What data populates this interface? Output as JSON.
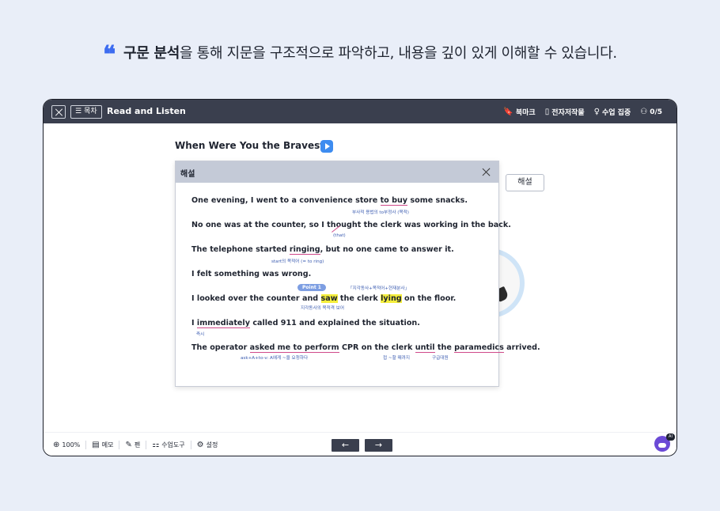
{
  "headline": {
    "quote": "❝",
    "bold": "구문 분석",
    "rest": "을 통해 지문을 구조적으로 파악하고, 내용을 깊이 있게 이해할 수 있습니다."
  },
  "topbar": {
    "toc_label": "목차",
    "title": "Read and Listen",
    "tools": [
      {
        "icon": "bookmark-icon",
        "glyph": "🔖",
        "label": "북마크"
      },
      {
        "icon": "ebook-icon",
        "glyph": "▯",
        "label": "전자저작물"
      },
      {
        "icon": "bulb-icon",
        "glyph": "♀",
        "label": "수업 집중"
      },
      {
        "icon": "users-icon",
        "glyph": "⚇",
        "label": "0/5"
      }
    ]
  },
  "page": {
    "title": "When Were You the Bravest?"
  },
  "explain_button": "해설",
  "modal": {
    "title": "해설",
    "s1": {
      "a": "One evening, I went to a convenience store ",
      "u": "to buy",
      "b": " some snacks.",
      "note": "부사적 용법의 to부정사 (목적)"
    },
    "s2": {
      "a": "No one was at the counter, so I thought",
      "b": " the clerk was working in the back.",
      "note": "(that)"
    },
    "s3": {
      "a": "The telephone started ",
      "u": "ringing",
      "b": ", but no one came to answer it.",
      "note": "start의 목적어 (= to ring)"
    },
    "s4": {
      "text": "I felt something was wrong."
    },
    "s5": {
      "a": "I looked over the counter and ",
      "h1": "saw",
      "m": " the clerk ",
      "h2": "lying",
      "b": " on the floor.",
      "badge": "Point 1",
      "note_top": "「지각동사+목적어+현재분사」",
      "note": "지각동사의 목적격 보어"
    },
    "s6": {
      "a": "I ",
      "u": "immediately",
      "b": " called 911 and explained the situation.",
      "note": "즉시"
    },
    "s7": {
      "a": "The operator ",
      "u1": "asked me to perform",
      "m": " CPR on the clerk ",
      "u2": "until",
      "m2": " the ",
      "u3": "paramedics",
      "b": " arrived.",
      "n1": "ask+A+to-v: A에게 ~을 요청하다",
      "n2": "접 ~할 때까지",
      "n3": "구급대원"
    }
  },
  "bottombar": {
    "tools": [
      {
        "icon": "zoom-icon",
        "glyph": "⊕",
        "label": "100%"
      },
      {
        "icon": "memo-icon",
        "glyph": "▤",
        "label": "메모"
      },
      {
        "icon": "pen-icon",
        "glyph": "✎",
        "label": "펜"
      },
      {
        "icon": "class-tools-icon",
        "glyph": "⚏",
        "label": "수업도구"
      },
      {
        "icon": "settings-icon",
        "glyph": "⚙",
        "label": "설정"
      }
    ],
    "prev": "←",
    "next": "→",
    "ai_badge": "AI"
  }
}
